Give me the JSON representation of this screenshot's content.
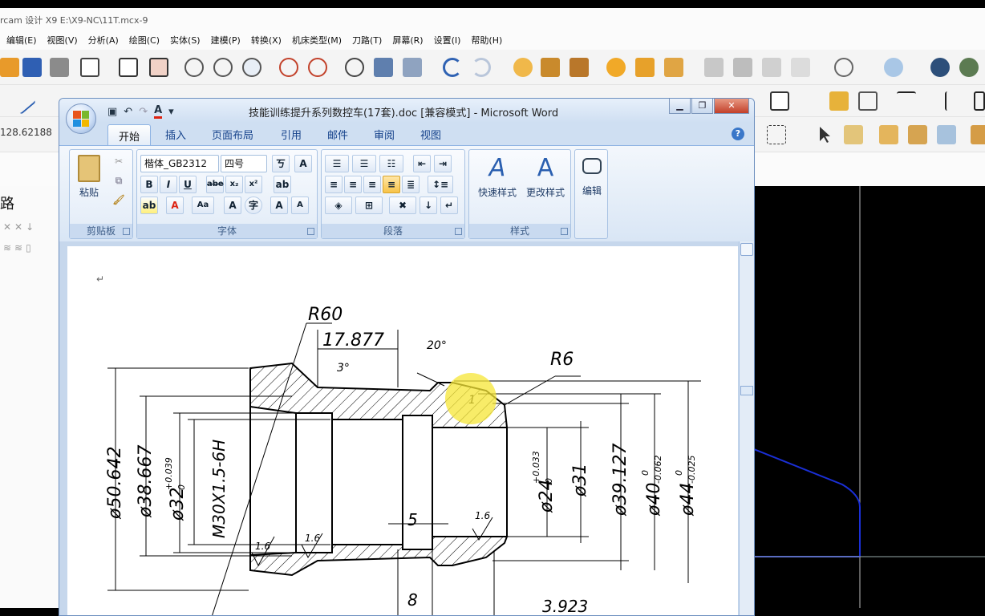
{
  "mastercam": {
    "title": "rcam 设计 X9   E:\\X9-NC\\11T.mcx-9",
    "menu": [
      "编辑(E)",
      "视图(V)",
      "分析(A)",
      "绘图(C)",
      "实体(S)",
      "建模(P)",
      "转换(X)",
      "机床类型(M)",
      "刀路(T)",
      "屏幕(R)",
      "设置(I)",
      "帮助(H)"
    ],
    "coord_value": "128.62188",
    "left_panel_label": "路"
  },
  "word": {
    "window_title": "技能训练提升系列数控车(17套).doc [兼容模式] - Microsoft Word",
    "tabs": [
      "开始",
      "插入",
      "页面布局",
      "引用",
      "邮件",
      "审阅",
      "视图"
    ],
    "help": "?",
    "ribbon": {
      "clipboard": {
        "label": "剪贴板",
        "paste": "粘贴"
      },
      "font": {
        "label": "字体",
        "font_name": "楷体_GB2312",
        "font_size": "四号",
        "bold": "B",
        "italic": "I",
        "underline": "U",
        "strike": "abe",
        "sub": "x₂",
        "sup": "x²",
        "aa": "Aa",
        "A": "A"
      },
      "paragraph": {
        "label": "段落"
      },
      "styles": {
        "label": "样式",
        "quick_styles": "快速样式",
        "change_styles": "更改样式"
      },
      "editing": {
        "label": "编辑"
      }
    },
    "drawing": {
      "dims": {
        "r60": "R60",
        "d17877": "17.877",
        "a20": "20°",
        "r6": "R6",
        "a3": "3°",
        "d50642": "ø50.642",
        "d38667": "ø38.667",
        "d32": "ø32",
        "d32_tol": "+0.039",
        "d32_tol0": "0",
        "m30": "M30X1.5-6H",
        "d5": "5",
        "d24": "ø24",
        "d24_tol": "+0.033",
        "d24_tol0": "0",
        "d31": "ø31",
        "d39127": "ø39.127",
        "d40": "ø40",
        "d40_tol": "-0.062",
        "d40_tol0": "0",
        "d44": "ø44",
        "d44_tol": "-0.025",
        "d44_tol0": "0",
        "rough_a": "1.6",
        "rough_b": "1.6",
        "rough_c": "1.6",
        "rough_d": "1",
        "d8": "8",
        "d3923": "3.923"
      }
    }
  }
}
